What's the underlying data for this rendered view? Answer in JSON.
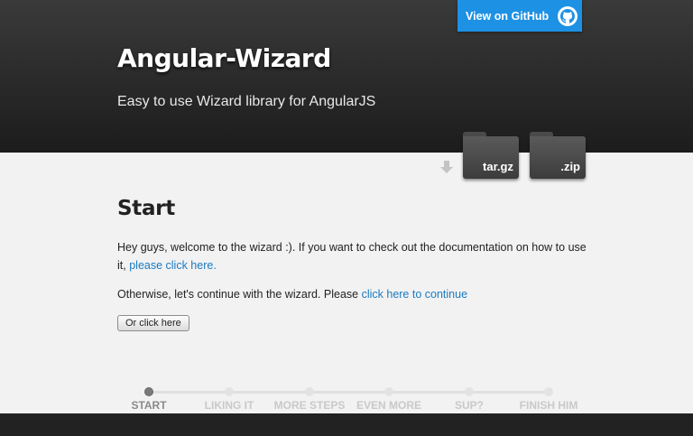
{
  "header": {
    "title": "Angular-Wizard",
    "subtitle": "Easy to use Wizard library for AngularJS",
    "github_label": "View on GitHub"
  },
  "downloads": {
    "targz_label": "tar.gz",
    "zip_label": ".zip"
  },
  "main": {
    "heading": "Start",
    "intro_text": "Hey guys, welcome to the wizard :). If you want to check out the documentation on how to use it,",
    "intro_link": "please click here.",
    "continue_text": "Otherwise, let's continue with the wizard. Please",
    "continue_link": "click here to continue",
    "button_label": "Or click here"
  },
  "steps": [
    {
      "label": "START",
      "active": true
    },
    {
      "label": "LIKING IT",
      "active": false
    },
    {
      "label": "MORE STEPS",
      "active": false
    },
    {
      "label": "EVEN MORE",
      "active": false
    },
    {
      "label": "SUP?",
      "active": false
    },
    {
      "label": "FINISH HIM",
      "active": false
    }
  ],
  "colors": {
    "accent": "#1d91e4",
    "link": "#1a7bc2",
    "header_bg": "#2a2a2a"
  }
}
